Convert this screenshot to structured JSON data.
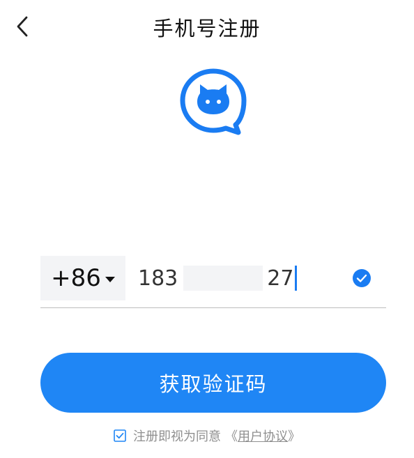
{
  "header": {
    "title": "手机号注册",
    "back_icon": "chevron-left-icon"
  },
  "logo": {
    "icon": "cat-chat-bubble-logo-icon",
    "color": "#1a7cf2"
  },
  "phone": {
    "country_code": "+86",
    "number_prefix": "183",
    "number_suffix": "27",
    "valid_icon": "check-circle-icon"
  },
  "actions": {
    "get_code_label": "获取验证码"
  },
  "agreement": {
    "checked": true,
    "text": "注册即视为同意",
    "link_open": "《",
    "link_label": "用户协议",
    "link_close": "》"
  },
  "colors": {
    "accent": "#1f86f5",
    "muted_text": "#8f8f8f",
    "field_bg": "#f3f4f6"
  }
}
